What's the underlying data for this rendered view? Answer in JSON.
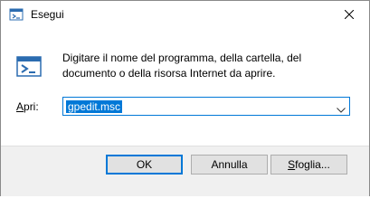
{
  "window": {
    "title": "Esegui",
    "description_line1": "Digitare il nome del programma, della cartella, del",
    "description_line2": "documento o della risorsa Internet da aprire."
  },
  "open_field": {
    "label_mnemonic": "A",
    "label_rest": "pri:",
    "value": "gpedit.msc"
  },
  "buttons": {
    "ok": "OK",
    "cancel": "Annulla",
    "browse_mnemonic": "S",
    "browse_rest": "foglia..."
  },
  "icons": {
    "app": "run-icon",
    "close": "close-icon",
    "dropdown": "chevron-down-icon"
  },
  "colors": {
    "accent": "#0078d7"
  }
}
